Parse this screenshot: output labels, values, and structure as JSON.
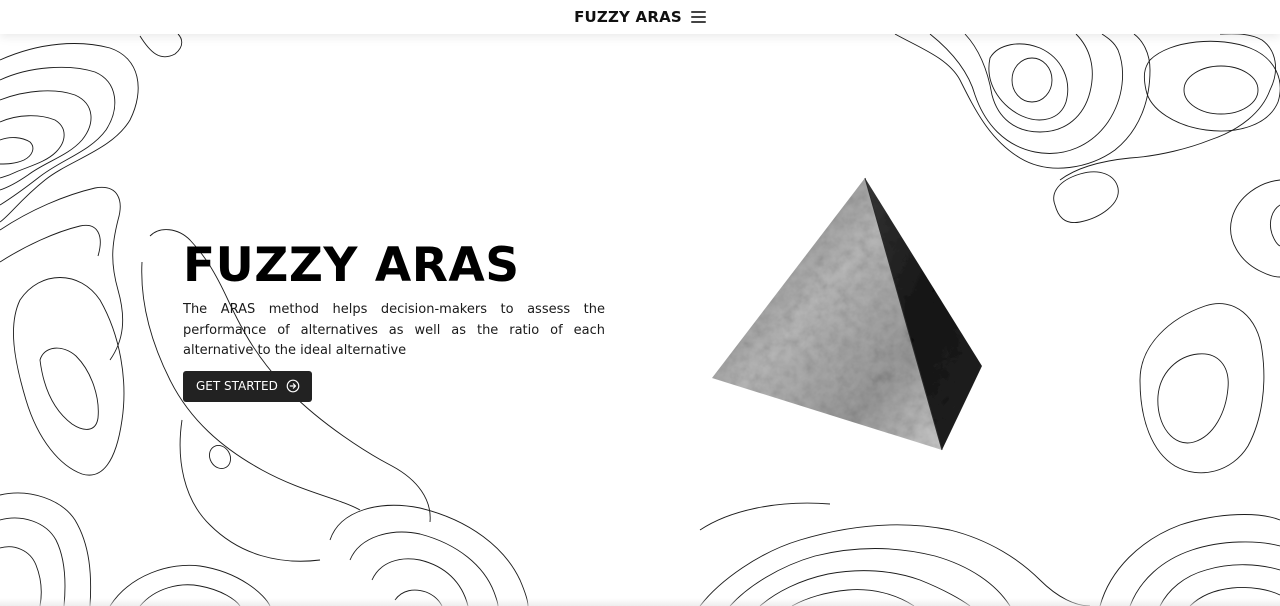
{
  "header": {
    "brand": "FUZZY ARAS",
    "menu_icon": "hamburger-menu-icon"
  },
  "hero": {
    "title": "FUZZY ARAS",
    "description": "The ARAS method helps decision-makers to assess the performance of alternatives as well as the ratio of each alternative to the ideal alternative",
    "cta_label": "GET STARTED",
    "cta_icon": "arrow-right-circle-icon"
  },
  "visual": {
    "object": "textured-pyramid",
    "background_pattern": "topographic-contour-lines"
  },
  "colors": {
    "background": "#ffffff",
    "text": "#000000",
    "button_bg": "#222222",
    "button_text": "#ffffff",
    "contour": "#1b1b1b"
  }
}
